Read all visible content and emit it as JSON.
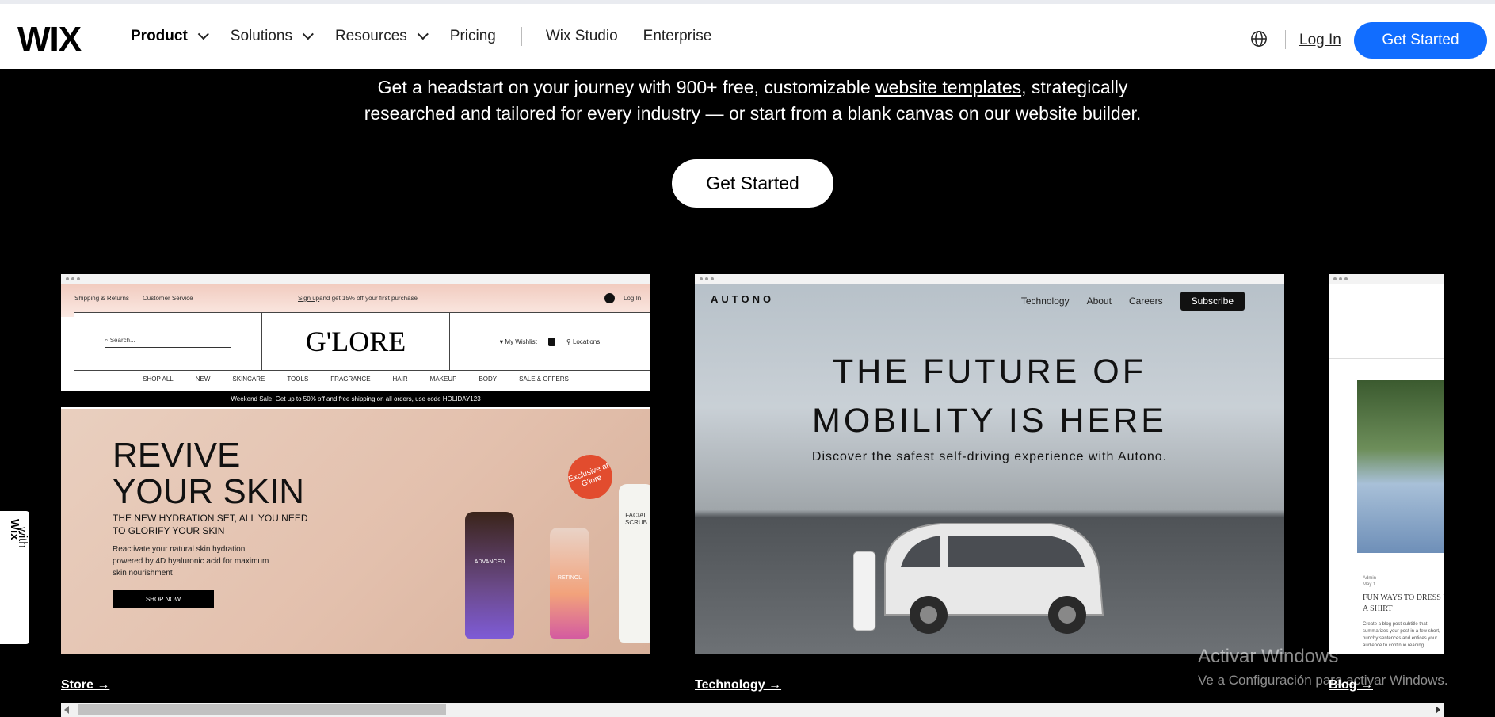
{
  "header": {
    "logo": "WIX",
    "nav": [
      {
        "label": "Product",
        "has_menu": true
      },
      {
        "label": "Solutions",
        "has_menu": true
      },
      {
        "label": "Resources",
        "has_menu": true
      },
      {
        "label": "Pricing",
        "has_menu": false
      },
      {
        "label": "Wix Studio",
        "has_menu": false
      },
      {
        "label": "Enterprise",
        "has_menu": false
      }
    ],
    "language_icon": "globe-icon",
    "login": "Log In",
    "cta": "Get Started",
    "accent": "#116dff"
  },
  "intro": {
    "line1_pre": "Get a headstart on your journey with 900+ free, customizable ",
    "line1_link": "website templates",
    "line1_post": ", strategically",
    "line2": "researched and tailored for every industry — or start from a blank canvas on our website builder.",
    "button": "Get Started"
  },
  "cards": {
    "store": {
      "link": "Store →",
      "top_left_1": "Shipping & Returns",
      "top_left_2": "Customer Service",
      "top_center_link": "Sign up",
      "top_center": " and get 15% off your first purchase",
      "login": "Log In",
      "search_placeholder": "Search...",
      "brand": "G'LORE",
      "wishlist": "My Wishlist",
      "locations": "Locations",
      "menu": [
        "SHOP ALL",
        "NEW",
        "SKINCARE",
        "TOOLS",
        "FRAGRANCE",
        "HAIR",
        "MAKEUP",
        "BODY",
        "SALE & OFFERS"
      ],
      "strip": "Weekend Sale! Get up to 50% off and free shipping on all orders, use code HOLIDAY123",
      "headline_1": "REVIVE",
      "headline_2": "YOUR SKIN",
      "subhead": "THE NEW HYDRATION SET, ALL YOU NEED TO GLORIFY YOUR SKIN",
      "body": "Reactivate your natural skin hydration powered by 4D hyaluronic acid for maximum skin nourishment",
      "cta": "SHOP NOW",
      "badge": "Exclusive at G'lore",
      "bottle_1": "ADVANCED",
      "bottle_2": "RETINOL",
      "tube": "FACIAL SCRUB"
    },
    "technology": {
      "link": "Technology →",
      "logo": "AUTONO",
      "nav": [
        "Technology",
        "About",
        "Careers"
      ],
      "subscribe": "Subscribe",
      "title_1": "THE FUTURE OF",
      "title_2": "MOBILITY IS HERE",
      "subtitle": "Discover the safest self-driving experience with Autono."
    },
    "blog": {
      "link": "Blog →",
      "author": "Admin",
      "date": "May 1",
      "post_title": "FUN WAYS TO DRESS UP A SHIRT",
      "excerpt": "Create a blog post subtitle that summarizes your post in a few short, punchy sentences and entices your audience to continue reading...."
    }
  },
  "side_tab": {
    "prefix": "Created with ",
    "brand": "Wix"
  },
  "watermark": {
    "line1": "Activar Windows",
    "line2": "Ve a Configuración para activar Windows."
  }
}
